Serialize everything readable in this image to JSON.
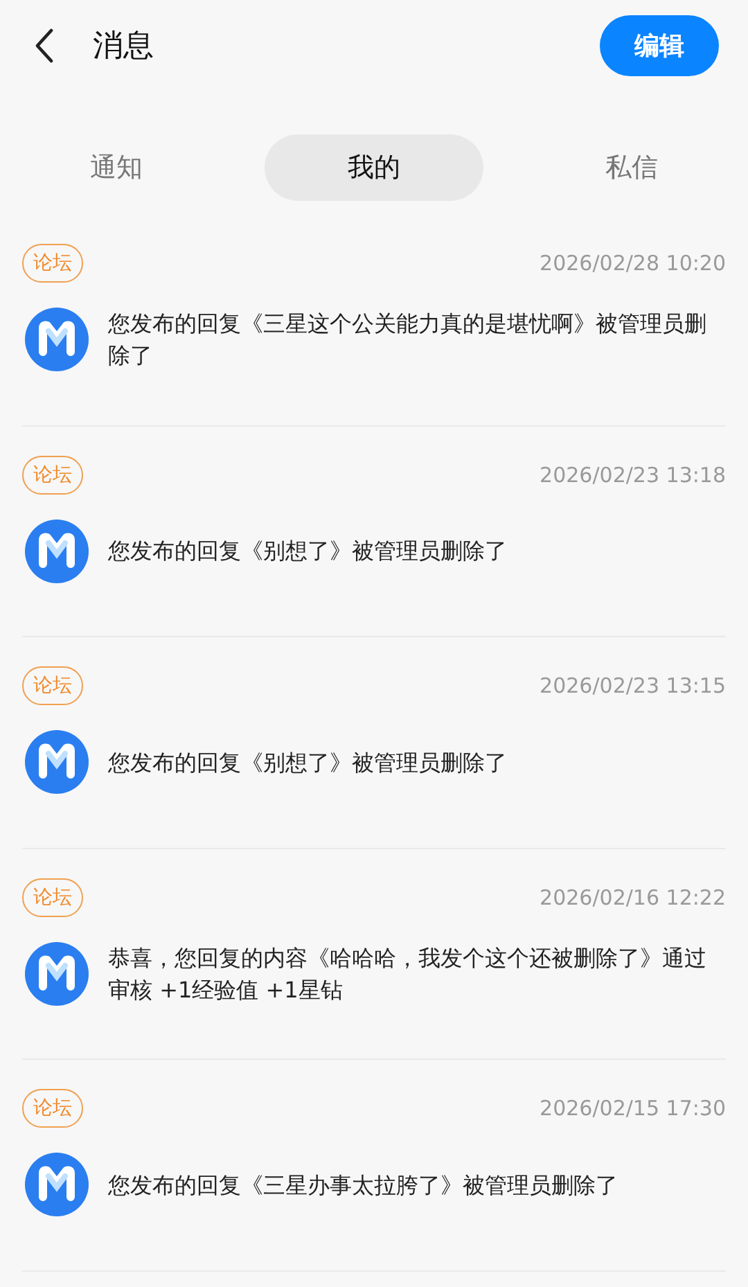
{
  "header": {
    "title": "消息",
    "edit_button": "编辑"
  },
  "tabs": [
    {
      "label": "通知",
      "selected": false
    },
    {
      "label": "我的",
      "selected": true
    },
    {
      "label": "私信",
      "selected": false
    }
  ],
  "messages": [
    {
      "tag": "论坛",
      "time": "2026/02/28 10:20",
      "text": "您发布的回复《三星这个公关能力真的是堪忧啊》被管理员删除了"
    },
    {
      "tag": "论坛",
      "time": "2026/02/23 13:18",
      "text": "您发布的回复《别想了》被管理员删除了"
    },
    {
      "tag": "论坛",
      "time": "2026/02/23 13:15",
      "text": "您发布的回复《别想了》被管理员删除了"
    },
    {
      "tag": "论坛",
      "time": "2026/02/16 12:22",
      "text": "恭喜，您回复的内容《哈哈哈，我发个这个还被删除了》通过审核 +1经验值 +1星钻"
    },
    {
      "tag": "论坛",
      "time": "2026/02/15 17:30",
      "text": "您发布的回复《三星办事太拉胯了》被管理员删除了"
    }
  ]
}
